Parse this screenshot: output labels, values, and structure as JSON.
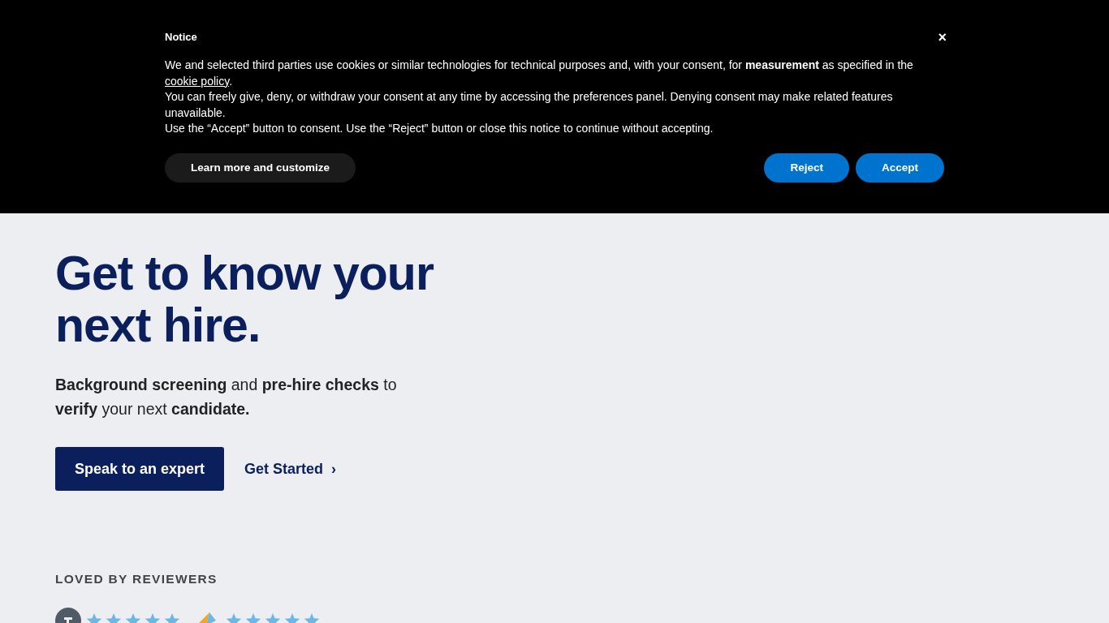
{
  "notice": {
    "title": "Notice",
    "paragraphs": [
      {
        "before": "We and selected third parties use cookies or similar technologies for technical purposes and, with your consent, for **measurement** as specified in the ",
        "link": "cookie policy",
        "after": "."
      },
      {
        "before": "You can freely give, deny, or withdraw your consent at any time by accessing the preferences panel. Denying consent may make related features unavailable."
      },
      {
        "before": "Use the “Accept” button to consent. Use the “Reject” button or close this notice to continue without accepting."
      }
    ],
    "close": "×",
    "customize_button": "Learn more and customize",
    "reject_button": "Reject",
    "accept_button": "Accept"
  },
  "hero": {
    "heading_lines": [
      "Get to know your",
      "next hire."
    ],
    "subtitle": "**Background screening** and **pre-hire checks** to **verify** your next **candidate.**",
    "primary_button": "Speak to an expert",
    "secondary_link": "Get Started",
    "secondary_icon": "›"
  },
  "reviews": {
    "heading": "LOVED BY REVIEWERS",
    "items": [
      {
        "kind": "circle",
        "stars": 5
      },
      {
        "kind": "wing",
        "stars": 5
      }
    ]
  }
}
